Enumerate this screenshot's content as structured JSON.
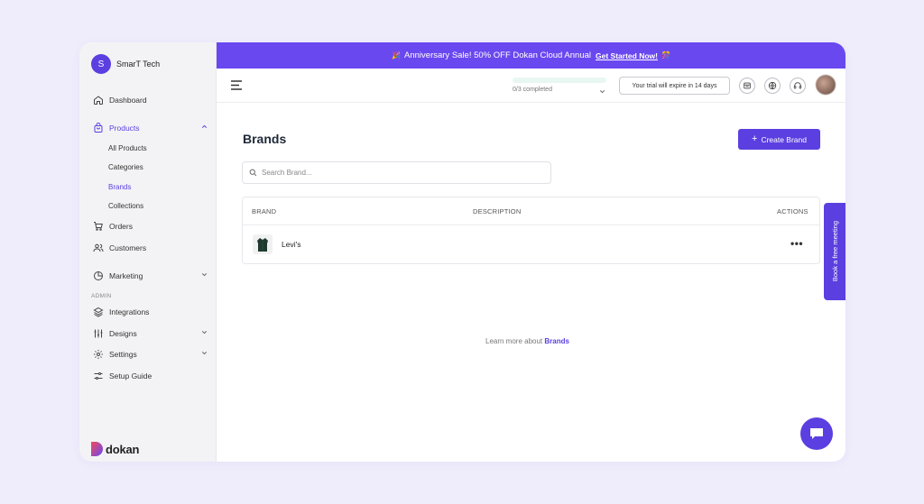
{
  "store": {
    "initial": "S",
    "name": "SmarT Tech"
  },
  "sidebar": {
    "items": [
      {
        "label": "Dashboard",
        "icon": "home-icon"
      },
      {
        "label": "Products",
        "icon": "shopping-bag-icon",
        "active": true,
        "expanded": true
      },
      {
        "label": "Orders",
        "icon": "cart-icon"
      },
      {
        "label": "Customers",
        "icon": "users-icon"
      },
      {
        "label": "Marketing",
        "icon": "pie-chart-icon",
        "has_dropdown": true
      }
    ],
    "product_subitems": [
      "All Products",
      "Categories",
      "Brands",
      "Collections"
    ],
    "active_subitem": "Brands",
    "admin_label": "ADMIN",
    "admin_items": [
      {
        "label": "Integrations",
        "icon": "layers-icon"
      },
      {
        "label": "Designs",
        "icon": "sliders-icon",
        "has_dropdown": true
      },
      {
        "label": "Settings",
        "icon": "gear-icon",
        "has_dropdown": true
      },
      {
        "label": "Setup Guide",
        "icon": "settings-sliders-icon"
      }
    ]
  },
  "logo": {
    "text": "dokan"
  },
  "banner": {
    "text": "Anniversary Sale! 50% OFF Dokan Cloud Annual",
    "cta": "Get Started Now!",
    "leading_emoji": "🎉",
    "trailing_emoji": "🎊"
  },
  "topbar": {
    "progress_text": "0/3 completed",
    "progress_value": 0,
    "trial_text": "Your trial will expire in 14 days"
  },
  "page": {
    "title": "Brands",
    "create_button": "Create Brand",
    "search_placeholder": "Search Brand...",
    "columns": [
      "BRAND",
      "DESCRIPTION",
      "ACTIONS"
    ],
    "rows": [
      {
        "name": "Levi's",
        "description": "",
        "actions": "•••"
      }
    ],
    "learn_more_text": "Learn more about",
    "learn_more_link": "Brands"
  },
  "meeting_tab": "Book a free meeting",
  "colors": {
    "accent": "#5b3fe0",
    "banner": "#6a48f0",
    "sidebar_bg": "#f3f3f5",
    "page_bg": "#efedfb",
    "progress": "#10b981"
  }
}
